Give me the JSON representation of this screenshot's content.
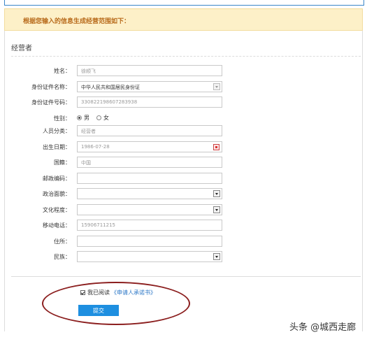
{
  "notice": {
    "text": "根据您输入的信息生成经营范围如下："
  },
  "section": {
    "title": "经营者"
  },
  "form": {
    "name": {
      "label": "姓名：",
      "value": "徐顺飞"
    },
    "id_type": {
      "label": "身份证件名称：",
      "value": "中华人民共和国居民身份证"
    },
    "id_number": {
      "label": "身份证件号码：",
      "value": "330822198607283938"
    },
    "gender": {
      "label": "性别：",
      "options": [
        "男",
        "女"
      ],
      "selected": "男"
    },
    "category": {
      "label": "人员分类：",
      "value": "经营者"
    },
    "birth_date": {
      "label": "出生日期：",
      "value": "1986-07-28"
    },
    "nationality": {
      "label": "国籍：",
      "value": "中国"
    },
    "postal_code": {
      "label": "邮政编码：",
      "value": ""
    },
    "political_status": {
      "label": "政治面貌：",
      "value": ""
    },
    "education": {
      "label": "文化程度：",
      "value": ""
    },
    "mobile": {
      "label": "移动电话：",
      "value": "15906711215"
    },
    "address": {
      "label": "住所：",
      "value": ""
    },
    "ethnicity": {
      "label": "民族：",
      "value": ""
    }
  },
  "agreement": {
    "checked": true,
    "prefix": "我已阅读",
    "link": "《申请人承诺书》"
  },
  "submit": {
    "label": "提交"
  },
  "watermark": {
    "text": "头条 @城西走廊"
  },
  "colors": {
    "accent": "#1e8fe0",
    "notice_bg": "#fdf0c8",
    "notice_text": "#b86a1a",
    "annotation_circle": "#8b1e1e"
  }
}
